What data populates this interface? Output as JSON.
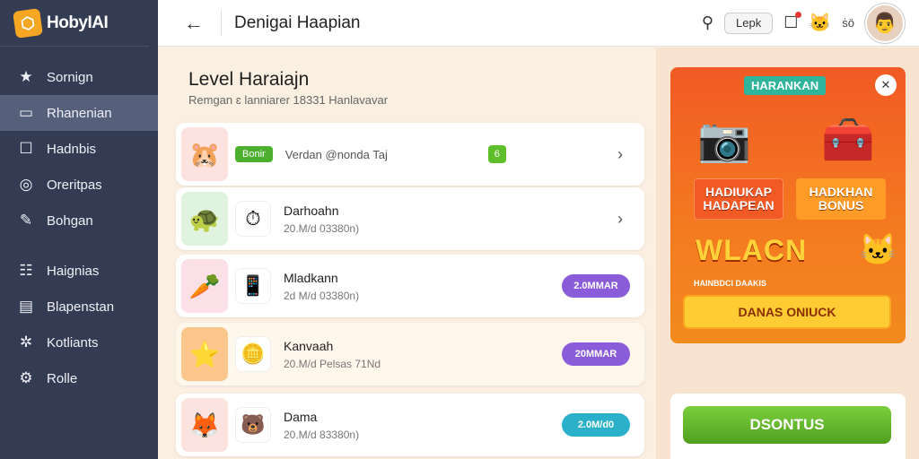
{
  "brand": {
    "name": "HobyIAI"
  },
  "sidebar": {
    "items": [
      {
        "label": "Sornign",
        "icon": "star-icon"
      },
      {
        "label": "Rhanenian",
        "icon": "card-icon"
      },
      {
        "label": "Hadnbis",
        "icon": "square-icon"
      },
      {
        "label": "Oreritpas",
        "icon": "chat-icon"
      },
      {
        "label": "Bohgan",
        "icon": "pen-icon"
      },
      {
        "label": "Haignias",
        "icon": "list-icon"
      },
      {
        "label": "Blapenstan",
        "icon": "doc-icon"
      },
      {
        "label": "Kotliants",
        "icon": "gear-icon"
      },
      {
        "label": "Rolle",
        "icon": "settings-icon"
      }
    ]
  },
  "topbar": {
    "title": "Denigai Haapian",
    "lock_label": "Lepk",
    "status_text": "ṡö"
  },
  "main": {
    "title": "Level Haraiajn",
    "subtitle": "Remgan ɛ lanniarer 18331 Hanlavavar",
    "rows": [
      {
        "tag": "Bonir",
        "text": "Verdan @nonda Taj",
        "badge": "6"
      },
      {
        "name": "Darhoahn",
        "meta": "20.M/d 03380n)"
      },
      {
        "name": "Mladkann",
        "meta": "2d M/d 03380n)",
        "button": "2.0MMAR"
      },
      {
        "name": "Kanvaah",
        "meta": "20.M/d Pelsas 71Nd",
        "button": "20MMAR"
      },
      {
        "name": "Dama",
        "meta": "20.M/d 83380n)",
        "button": "2.0M/d0"
      }
    ]
  },
  "promo": {
    "header": "HARANKAN",
    "box_a": [
      "HADIUKAP",
      "HADAPEAN"
    ],
    "box_b": [
      "HADKHAN",
      "BONUS"
    ],
    "big_text": "WLACN",
    "small_text": "HAINBDCI DAAKIS",
    "cta": "DANAS ONIUCK",
    "bonus_button": "DSONTUS"
  },
  "colors": {
    "sidebar_bg": "#333c53",
    "accent_purple": "#8a5cd9",
    "accent_teal": "#2bb0c9",
    "promo_orange": "#f15a24",
    "bonus_green": "#5cae27"
  }
}
